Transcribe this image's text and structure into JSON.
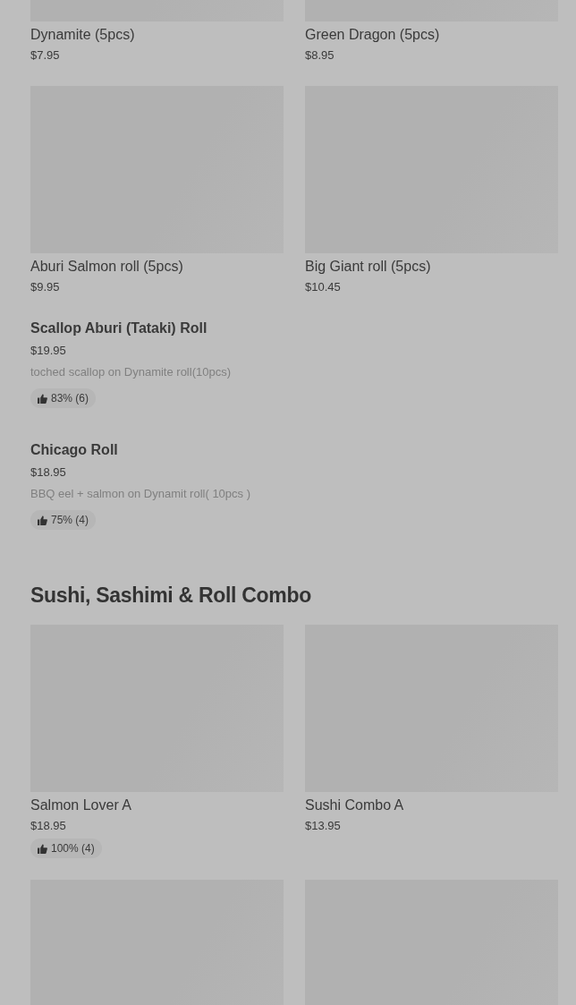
{
  "sections": [
    {
      "blocks": [
        {
          "kind": "grid",
          "items": [
            {
              "kind": "item",
              "name": "Dynamite (5pcs)",
              "price": "$7.95"
            },
            {
              "kind": "item",
              "name": "Green Dragon (5pcs)",
              "price": "$8.95"
            },
            {
              "kind": "item",
              "name": "Aburi Salmon roll (5pcs)",
              "price": "$9.95"
            },
            {
              "kind": "item",
              "name": "Big Giant roll (5pcs)",
              "price": "$10.45"
            }
          ]
        },
        {
          "kind": "list",
          "items": [
            {
              "name": "Scallop Aburi (Tataki) Roll",
              "price": "$19.95",
              "description": "toched scallop on Dynamite roll(10pcs)",
              "rating": "83% (6)"
            },
            {
              "name": "Chicago Roll",
              "price": "$18.95",
              "description": "BBQ eel + salmon on Dynamit roll( 10pcs )",
              "rating": "75% (4)"
            }
          ]
        }
      ]
    },
    {
      "title": "Sushi, Sashimi & Roll Combo",
      "blocks": [
        {
          "kind": "grid",
          "items": [
            {
              "kind": "item",
              "name": "Salmon Lover A",
              "price": "$18.95",
              "rating": "100% (4)"
            },
            {
              "kind": "item",
              "name": "Sushi Combo A",
              "price": "$13.95"
            },
            {
              "kind": "picture"
            },
            {
              "kind": "picture"
            }
          ]
        }
      ]
    }
  ]
}
